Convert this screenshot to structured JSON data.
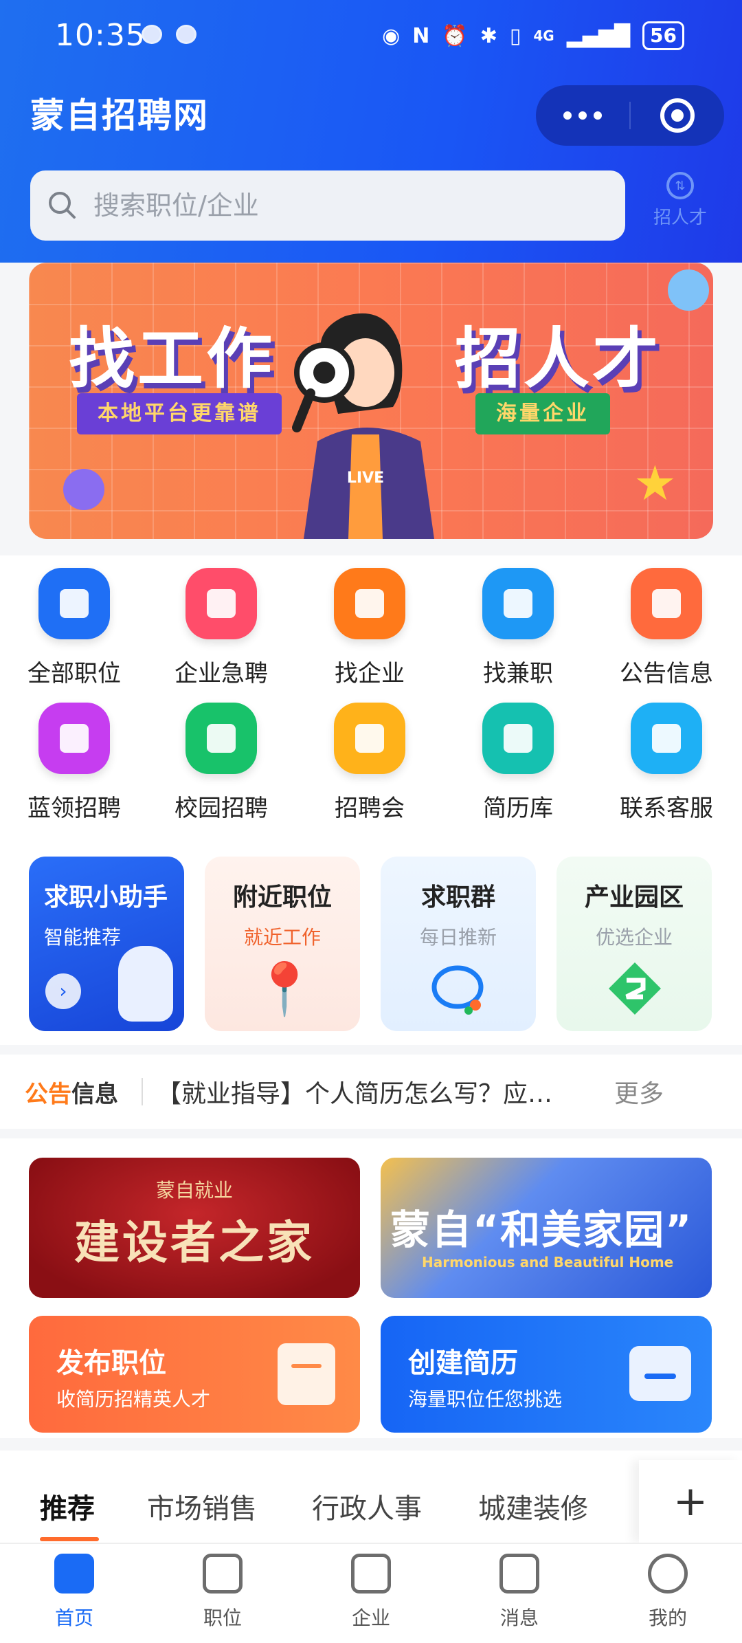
{
  "status_bar": {
    "time": "10:35",
    "network": "4G",
    "battery": "56"
  },
  "header": {
    "app_title": "蒙自招聘网",
    "search_placeholder": "搜索职位/企业",
    "recruit_label": "招人才"
  },
  "banner": {
    "left_title": "找工作",
    "left_tag": "本地平台更靠谱",
    "right_title": "招人才",
    "right_tag": "海量企业",
    "shirt_text": "LIVE"
  },
  "quick_menu": [
    {
      "label": "全部职位",
      "icon": "tie-icon",
      "color": "#1f6ff5"
    },
    {
      "label": "企业急聘",
      "icon": "briefcase-bolt-icon",
      "color": "#ff4d6a"
    },
    {
      "label": "找企业",
      "icon": "building-icon",
      "color": "#ff7a1a"
    },
    {
      "label": "找兼职",
      "icon": "compass-icon",
      "color": "#1e98f5"
    },
    {
      "label": "公告信息",
      "icon": "speaker-icon",
      "color": "#ff6a3d"
    },
    {
      "label": "蓝领招聘",
      "icon": "hardhat-icon",
      "color": "#c63df0"
    },
    {
      "label": "校园招聘",
      "icon": "graduation-cap-icon",
      "color": "#18c26a"
    },
    {
      "label": "招聘会",
      "icon": "calendar-check-icon",
      "color": "#ffb21a"
    },
    {
      "label": "简历库",
      "icon": "folder-icon",
      "color": "#15c1b0"
    },
    {
      "label": "联系客服",
      "icon": "chat-bubble-icon",
      "color": "#1eb0f5"
    }
  ],
  "cards": [
    {
      "title": "求职小助手",
      "subtitle": "智能推荐"
    },
    {
      "title": "附近职位",
      "subtitle": "就近工作",
      "subcolor": "#f0622c"
    },
    {
      "title": "求职群",
      "subtitle": "每日推新",
      "subcolor": "#9aa0aa"
    },
    {
      "title": "产业园区",
      "subtitle": "优选企业",
      "subcolor": "#9aa0aa"
    }
  ],
  "notice": {
    "label_a": "公告",
    "label_b": "信息",
    "text": "【就业指导】个人简历怎么写？应…",
    "more": "更多"
  },
  "features": {
    "home_small": "蒙自就业",
    "home_big": "建设者之家",
    "garden_big": "蒙自“和美家园”",
    "garden_en": "Harmonious and Beautiful Home",
    "post_title": "发布职位",
    "post_sub": "收简历招精英人才",
    "resume_title": "创建简历",
    "resume_sub": "海量职位任您挑选"
  },
  "tabs": [
    "推荐",
    "市场销售",
    "行政人事",
    "城建装修"
  ],
  "tab_plus": "+",
  "bottom_nav": [
    {
      "label": "首页",
      "active": true
    },
    {
      "label": "职位"
    },
    {
      "label": "企业"
    },
    {
      "label": "消息"
    },
    {
      "label": "我的"
    }
  ]
}
